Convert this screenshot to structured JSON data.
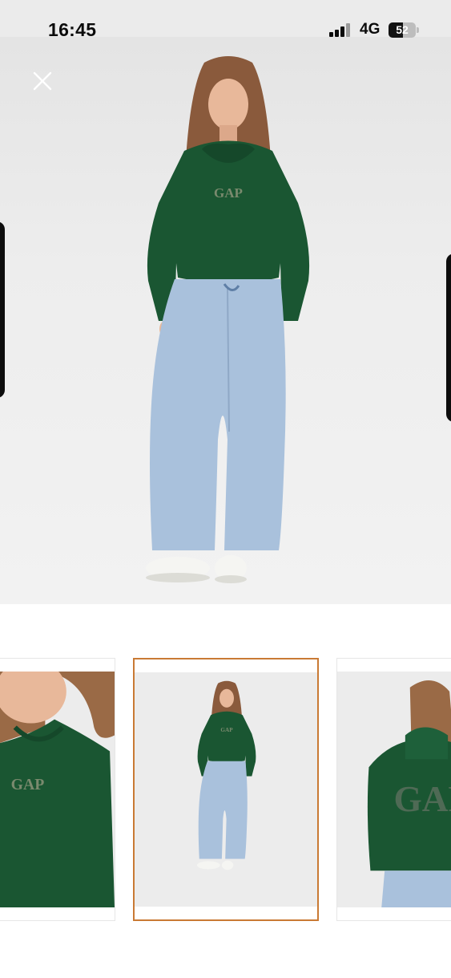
{
  "status_bar": {
    "time": "16:45",
    "network": "4G",
    "battery_level": "52",
    "battery_percent": 52,
    "signal_bars": 3
  },
  "hero_image": {
    "alt": "Model wearing green hoodie and light wash barrel jeans",
    "logo_text": "GAP"
  },
  "close_button": {
    "icon": "close-icon"
  },
  "thumbnails": [
    {
      "label": "Hoodie front detail",
      "logo_text": "GAP",
      "selected": false
    },
    {
      "label": "Full outfit front view",
      "logo_text": "GAP",
      "selected": true
    },
    {
      "label": "Hoodie back view",
      "logo_text": "GAP",
      "selected": false
    }
  ],
  "colors": {
    "hoodie_green": "#1a5632",
    "denim": "#a9c1dc",
    "selected_border": "#c97a34",
    "background": "#ececec"
  }
}
